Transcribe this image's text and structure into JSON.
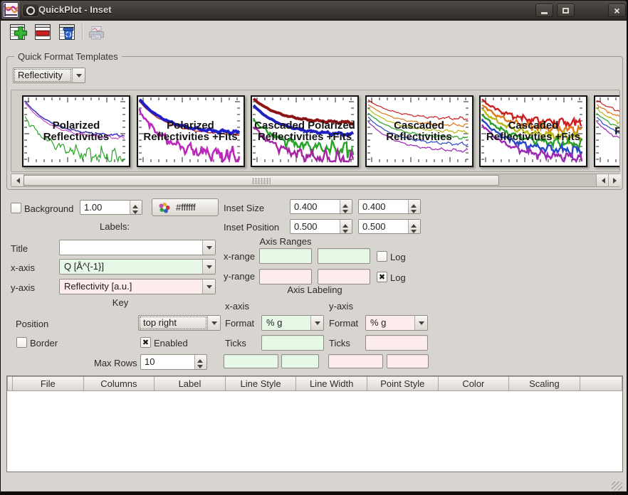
{
  "titlebar": {
    "title": "QuickPlot - Inset"
  },
  "toolbar": {
    "icons": [
      "add-row",
      "remove-row",
      "clear-rows",
      "print-plot"
    ]
  },
  "quick_format": {
    "label": "Quick Format Templates",
    "selected_template": "Reflectivity",
    "templates": [
      {
        "label": "Polarized Reflectivities",
        "series": [
          {
            "color": "#4838c0",
            "width": 1.6,
            "noise": 0.7,
            "y0": 0.06,
            "y1": 0.6
          },
          {
            "color": "#c040c0",
            "width": 1.1,
            "noise": 0.9,
            "y0": 0.09,
            "y1": 0.64
          },
          {
            "color": "#28a828",
            "width": 1.2,
            "noise": 4.5,
            "y0": 0.3,
            "y1": 0.92
          }
        ]
      },
      {
        "label": "Polarized Reflectivities +Fits",
        "series": [
          {
            "color": "#b82424",
            "width": 1.4,
            "noise": 0.6,
            "y0": 0.07,
            "y1": 0.58
          },
          {
            "color": "#1f1fcc",
            "width": 4,
            "noise": 0.9,
            "y0": 0.04,
            "y1": 0.55
          },
          {
            "color": "#bc28bc",
            "width": 2.6,
            "noise": 4.2,
            "y0": 0.2,
            "y1": 0.9
          }
        ]
      },
      {
        "label": "Cascaded Polarized Reflectivities +Fits",
        "series": [
          {
            "color": "#8c1414",
            "width": 4,
            "noise": 0.7,
            "y0": 0.03,
            "y1": 0.4
          },
          {
            "color": "#2020c0",
            "width": 4,
            "noise": 0.8,
            "y0": 0.13,
            "y1": 0.58
          },
          {
            "color": "#28a428",
            "width": 2.4,
            "noise": 3.6,
            "y0": 0.34,
            "y1": 0.8
          },
          {
            "color": "#a424a4",
            "width": 2.4,
            "noise": 4.2,
            "y0": 0.45,
            "y1": 0.95
          }
        ]
      },
      {
        "label": "Cascaded Reflectivities",
        "series": [
          {
            "color": "#cc2020",
            "width": 1.2,
            "noise": 0.9,
            "y0": 0.05,
            "y1": 0.34
          },
          {
            "color": "#e07818",
            "width": 1.2,
            "noise": 0.9,
            "y0": 0.115,
            "y1": 0.44
          },
          {
            "color": "#b8b818",
            "width": 1.2,
            "noise": 0.9,
            "y0": 0.18,
            "y1": 0.54
          },
          {
            "color": "#28a028",
            "width": 1.2,
            "noise": 0.9,
            "y0": 0.245,
            "y1": 0.63
          },
          {
            "color": "#2848c8",
            "width": 1.2,
            "noise": 0.9,
            "y0": 0.31,
            "y1": 0.73
          },
          {
            "color": "#9c28b4",
            "width": 1.2,
            "noise": 0.9,
            "y0": 0.375,
            "y1": 0.83
          }
        ]
      },
      {
        "label": "Cascaded Reflectivities +Fits",
        "series": [
          {
            "color": "#cc2020",
            "width": 2.4,
            "noise": 2.4,
            "y0": 0.04,
            "y1": 0.4
          },
          {
            "color": "#e07818",
            "width": 2.4,
            "noise": 2.4,
            "y0": 0.115,
            "y1": 0.505
          },
          {
            "color": "#b8b818",
            "width": 2.4,
            "noise": 2.4,
            "y0": 0.19,
            "y1": 0.61
          },
          {
            "color": "#28a028",
            "width": 2.4,
            "noise": 2.4,
            "y0": 0.265,
            "y1": 0.715
          },
          {
            "color": "#2848c8",
            "width": 2.4,
            "noise": 2.4,
            "y0": 0.34,
            "y1": 0.82
          },
          {
            "color": "#9c28b4",
            "width": 2.4,
            "noise": 2.4,
            "y0": 0.415,
            "y1": 0.925
          }
        ]
      },
      {
        "label": "Reflectivities",
        "series": [
          {
            "color": "#cc2020",
            "width": 1.2,
            "noise": 1.6,
            "y0": 0.05,
            "y1": 0.34
          },
          {
            "color": "#e07818",
            "width": 1.2,
            "noise": 1.6,
            "y0": 0.115,
            "y1": 0.44
          },
          {
            "color": "#b8b818",
            "width": 1.2,
            "noise": 1.6,
            "y0": 0.18,
            "y1": 0.54
          },
          {
            "color": "#28a028",
            "width": 1.2,
            "noise": 1.6,
            "y0": 0.245,
            "y1": 0.63
          },
          {
            "color": "#2848c8",
            "width": 1.2,
            "noise": 1.6,
            "y0": 0.31,
            "y1": 0.73
          },
          {
            "color": "#9c28b4",
            "width": 1.2,
            "noise": 1.6,
            "y0": 0.375,
            "y1": 0.83
          }
        ]
      }
    ]
  },
  "inset": {
    "background_label": "Background",
    "background_checked": false,
    "opacity": "1.00",
    "color_hex": "#ffffff",
    "size_label": "Inset Size",
    "size_x": "0.400",
    "size_y": "0.400",
    "position_label": "Inset Position",
    "pos_x": "0.500",
    "pos_y": "0.500"
  },
  "labels": {
    "header": "Labels:",
    "title_label": "Title",
    "title_value": "",
    "xaxis_label": "x-axis",
    "xaxis_value": "Q [Å^{-1}]",
    "yaxis_label": "y-axis",
    "yaxis_value": "Reflectivity [a.u.]"
  },
  "axis_ranges": {
    "header": "Axis Ranges",
    "xrange_label": "x-range",
    "yrange_label": "y-range",
    "x_min": "",
    "x_max": "",
    "y_min": "",
    "y_max": "",
    "xlog_label": "Log",
    "ylog_label": "Log",
    "x_log": false,
    "y_log": true
  },
  "axis_labeling": {
    "header": "Axis Labeling",
    "x_col": "x-axis",
    "y_col": "y-axis",
    "format_label_x": "Format",
    "format_label_y": "Format",
    "x_format": "% g",
    "y_format": "% g",
    "ticks_label_x": "Ticks",
    "ticks_label_y": "Ticks",
    "x_ticks": "",
    "y_ticks": "",
    "x_extra1": "",
    "x_extra2": "",
    "y_extra1": "",
    "y_extra2": ""
  },
  "key": {
    "header": "Key",
    "position_label": "Position",
    "position_value": "top right",
    "border_label": "Border",
    "border_checked": false,
    "enabled_label": "Enabled",
    "enabled_checked": true,
    "max_rows_label": "Max Rows",
    "max_rows": "10"
  },
  "table": {
    "columns": [
      "File",
      "Columns",
      "Label",
      "Line Style",
      "Line Width",
      "Point Style",
      "Color",
      "Scaling"
    ],
    "rows": []
  }
}
